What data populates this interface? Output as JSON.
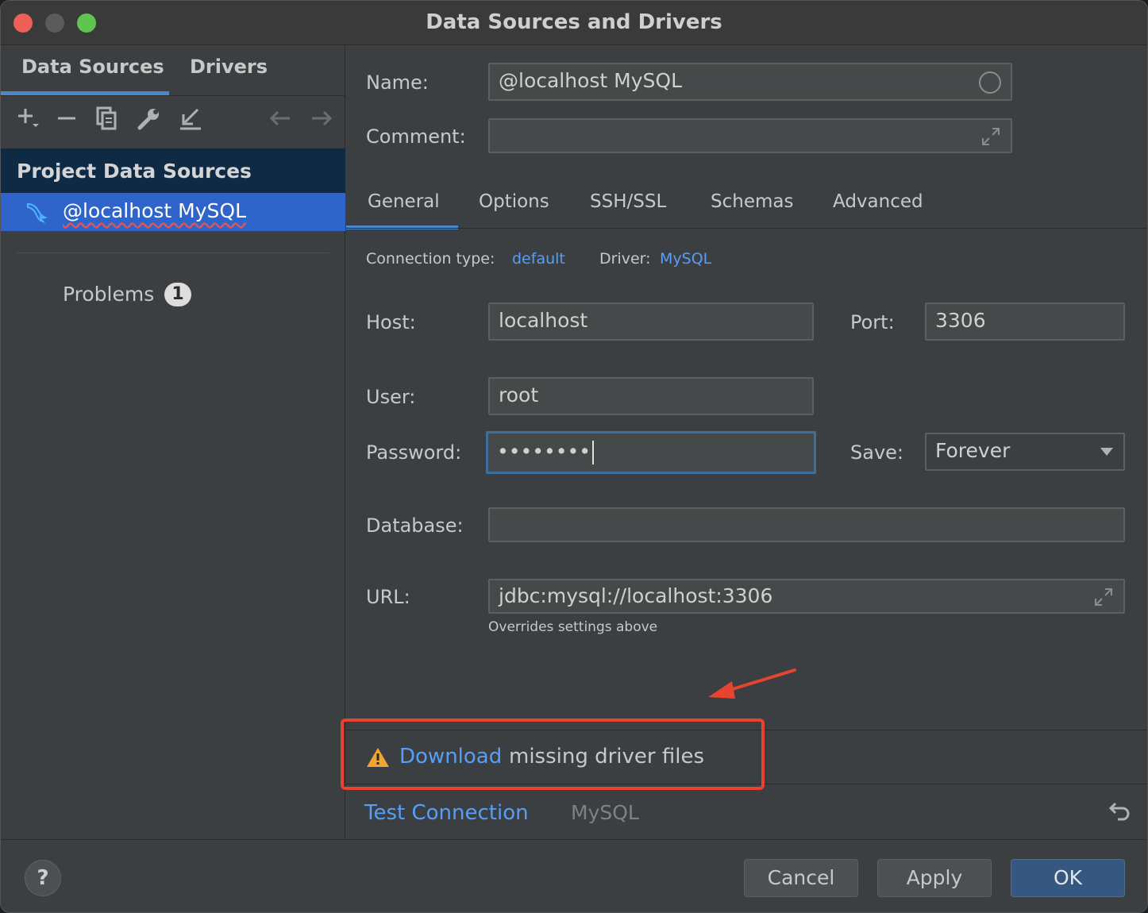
{
  "window": {
    "title": "Data Sources and Drivers"
  },
  "left_panel": {
    "tabs": [
      "Data Sources",
      "Drivers"
    ],
    "section_header": "Project Data Sources",
    "selected_item": "@localhost MySQL",
    "problems_label": "Problems",
    "problems_count": "1"
  },
  "form": {
    "name_label": "Name:",
    "name_value": "@localhost MySQL",
    "comment_label": "Comment:",
    "tabs": [
      "General",
      "Options",
      "SSH/SSL",
      "Schemas",
      "Advanced"
    ],
    "connection_type_label": "Connection type:",
    "connection_type_value": "default",
    "driver_label": "Driver:",
    "driver_value": "MySQL",
    "host_label": "Host:",
    "host_value": "localhost",
    "port_label": "Port:",
    "port_value": "3306",
    "user_label": "User:",
    "user_value": "root",
    "password_label": "Password:",
    "password_value": "••••••••",
    "save_label": "Save:",
    "save_value": "Forever",
    "database_label": "Database:",
    "url_label": "URL:",
    "url_value": "jdbc:mysql://localhost:3306",
    "url_hint": "Overrides settings above"
  },
  "warning": {
    "link": "Download",
    "text": "missing driver files"
  },
  "bottom_bar": {
    "test_connection": "Test Connection",
    "driver_name": "MySQL"
  },
  "footer": {
    "help": "?",
    "cancel": "Cancel",
    "apply": "Apply",
    "ok": "OK"
  },
  "colors": {
    "accent": "#589df6",
    "selection": "#2f65ca",
    "annotation": "#e8432f",
    "warning": "#f0a732"
  }
}
